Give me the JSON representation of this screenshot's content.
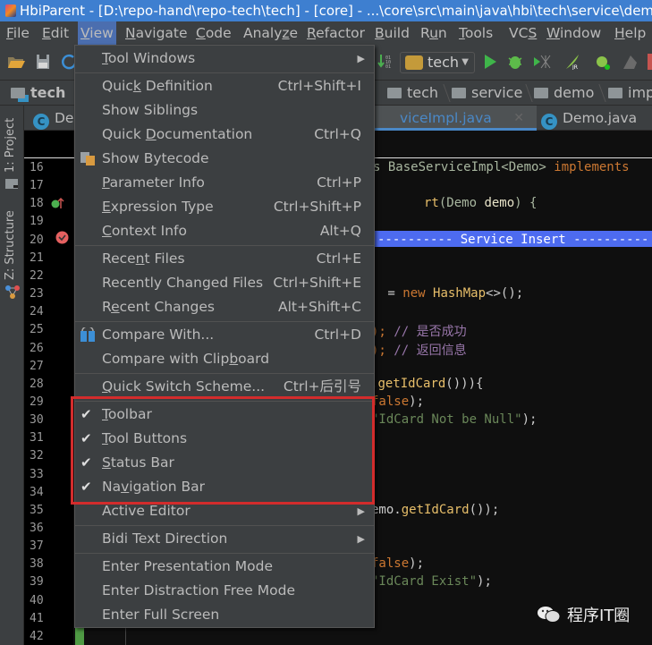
{
  "window": {
    "title": "HbiParent - [D:\\repo-hand\\repo-tech\\tech] - [core] - ...\\core\\src\\main\\java\\hbi\\tech\\service\\demo"
  },
  "menubar": {
    "items": [
      {
        "label": "File",
        "mnemonic": "F"
      },
      {
        "label": "Edit",
        "mnemonic": "E"
      },
      {
        "label": "View",
        "mnemonic": "V",
        "active": true
      },
      {
        "label": "Navigate",
        "mnemonic": "N"
      },
      {
        "label": "Code",
        "mnemonic": "C"
      },
      {
        "label": "Analyze",
        "mnemonic": "z"
      },
      {
        "label": "Refactor",
        "mnemonic": "R"
      },
      {
        "label": "Build",
        "mnemonic": "B"
      },
      {
        "label": "Run",
        "mnemonic": "u"
      },
      {
        "label": "Tools",
        "mnemonic": "T"
      },
      {
        "label": "VCS",
        "mnemonic": "S"
      },
      {
        "label": "Window",
        "mnemonic": "W"
      },
      {
        "label": "Help",
        "mnemonic": "H"
      }
    ]
  },
  "toolbar": {
    "run_config": "tech"
  },
  "navbar": {
    "crumbs": [
      "tech",
      "tech",
      "service",
      "demo",
      "imp"
    ]
  },
  "side_tabs": {
    "project": "1: Project",
    "structure": "Z: Structure"
  },
  "editor_tabs": [
    {
      "label": "De",
      "selected": false
    },
    {
      "label": "viceImpl.java",
      "selected": true
    },
    {
      "label": "Demo.java",
      "selected": false
    }
  ],
  "gutter": {
    "line_numbers": [
      "16",
      "17",
      "18",
      "19",
      "20",
      "21",
      "22",
      "23",
      "24",
      "25",
      "26",
      "27",
      "28",
      "29",
      "30",
      "31",
      "32",
      "33",
      "34",
      "35",
      "36",
      "37",
      "38",
      "39",
      "40",
      "41",
      "42"
    ]
  },
  "code_lines": [
    {
      "line": 16,
      "segments": [
        {
          "t": "s BaseServiceImpl<Demo> ",
          "c": "#a9b7a0"
        },
        {
          "t": "implements",
          "c": "#cc7832"
        }
      ]
    },
    {
      "line": 18,
      "segments": [
        {
          "t": "rt",
          "c": "#e8bf6a"
        },
        {
          "t": "(Demo ",
          "c": "#a9b7a0"
        },
        {
          "t": "demo",
          "c": "#e8e4c9"
        },
        {
          "t": ") {",
          "c": "#a9b7a0"
        }
      ]
    },
    {
      "line": 20,
      "segments": [
        {
          "t": "---------- Service Insert ----------",
          "c": "#ffffff"
        }
      ]
    },
    {
      "line": 23,
      "segments": [
        {
          "t": " = ",
          "c": "#cccccc"
        },
        {
          "t": "new ",
          "c": "#cc7832"
        },
        {
          "t": "HashMap",
          "c": "#e8bf6a"
        },
        {
          "t": "<>();",
          "c": "#cccccc"
        }
      ]
    },
    {
      "line": 25,
      "segments": [
        {
          "t": ");",
          "c": "#cc7832"
        },
        {
          "t": " // 是否成功",
          "c": "#9876aa"
        }
      ]
    },
    {
      "line": 26,
      "segments": [
        {
          "t": ");",
          "c": "#cc7832"
        },
        {
          "t": " // 返回信息",
          "c": "#9876aa"
        }
      ]
    },
    {
      "line": 28,
      "segments": [
        {
          "t": ".",
          "c": "#cccccc"
        },
        {
          "t": "getIdCard",
          "c": "#e8bf6a"
        },
        {
          "t": "())){",
          "c": "#cccccc"
        }
      ]
    },
    {
      "line": 29,
      "segments": [
        {
          "t": "false",
          "c": "#cc7832"
        },
        {
          "t": ");",
          "c": "#cccccc"
        }
      ]
    },
    {
      "line": 30,
      "segments": [
        {
          "t": "\"IdCard Not be Null\"",
          "c": "#6a8759"
        },
        {
          "t": ");",
          "c": "#cccccc"
        }
      ]
    },
    {
      "line": 35,
      "segments": [
        {
          "t": "emo.",
          "c": "#cccccc"
        },
        {
          "t": "getIdCard",
          "c": "#e8bf6a"
        },
        {
          "t": "());",
          "c": "#cccccc"
        }
      ]
    },
    {
      "line": 38,
      "segments": [
        {
          "t": "false",
          "c": "#cc7832"
        },
        {
          "t": ");",
          "c": "#cccccc"
        }
      ]
    },
    {
      "line": 39,
      "segments": [
        {
          "t": "\"IdCard Exist\"",
          "c": "#6a8759"
        },
        {
          "t": ");",
          "c": "#cccccc"
        }
      ]
    }
  ],
  "view_menu": {
    "items": [
      {
        "label": "Tool Windows",
        "mnemonic": "T",
        "shortcut": "",
        "submenu": true
      },
      {
        "separator": true
      },
      {
        "label": "Quick Definition",
        "mnemonic": "k",
        "shortcut": "Ctrl+Shift+I"
      },
      {
        "label": "Show Siblings",
        "shortcut": ""
      },
      {
        "label": "Quick Documentation",
        "mnemonic": "D",
        "shortcut": "Ctrl+Q"
      },
      {
        "label": "Show Bytecode",
        "shortcut": "",
        "icon": "bytecode-icon"
      },
      {
        "label": "Parameter Info",
        "mnemonic": "P",
        "shortcut": "Ctrl+P"
      },
      {
        "label": "Expression Type",
        "mnemonic": "E",
        "shortcut": "Ctrl+Shift+P"
      },
      {
        "label": "Context Info",
        "mnemonic": "C",
        "shortcut": "Alt+Q"
      },
      {
        "separator": true
      },
      {
        "label": "Recent Files",
        "mnemonic": "n",
        "shortcut": "Ctrl+E"
      },
      {
        "label": "Recently Changed Files",
        "shortcut": "Ctrl+Shift+E"
      },
      {
        "label": "Recent Changes",
        "mnemonic": "e",
        "shortcut": "Alt+Shift+C"
      },
      {
        "separator": true
      },
      {
        "label": "Compare With...",
        "shortcut": "Ctrl+D",
        "icon": "compare-icon"
      },
      {
        "label": "Compare with Clipboard",
        "mnemonic": "b",
        "shortcut": ""
      },
      {
        "separator": true
      },
      {
        "label": "Quick Switch Scheme...",
        "mnemonic": "Q",
        "shortcut": "Ctrl+后引号"
      },
      {
        "separator": true
      },
      {
        "label": "Toolbar",
        "mnemonic": "T",
        "shortcut": "",
        "checked": true
      },
      {
        "label": "Tool Buttons",
        "mnemonic": "T",
        "shortcut": "",
        "checked": true
      },
      {
        "label": "Status Bar",
        "mnemonic": "S",
        "shortcut": "",
        "checked": true
      },
      {
        "label": "Navigation Bar",
        "mnemonic": "v",
        "shortcut": "",
        "checked": true
      },
      {
        "label": "Active Editor",
        "shortcut": "",
        "submenu": true
      },
      {
        "separator": true
      },
      {
        "label": "Bidi Text Direction",
        "shortcut": "",
        "submenu": true
      },
      {
        "separator": true
      },
      {
        "label": "Enter Presentation Mode",
        "shortcut": ""
      },
      {
        "label": "Enter Distraction Free Mode",
        "shortcut": ""
      },
      {
        "label": "Enter Full Screen",
        "shortcut": ""
      }
    ]
  },
  "annotation": {
    "highlight_color": "#d32c2c"
  },
  "watermark": {
    "text": "程序IT圈"
  },
  "colors": {
    "titlebar": "#3e7fd0",
    "menu_bg": "#3c3f41",
    "menu_active": "#4b6eaf",
    "editor_bg": "#0f0f0f",
    "selection_band": "#4d6bf0"
  }
}
